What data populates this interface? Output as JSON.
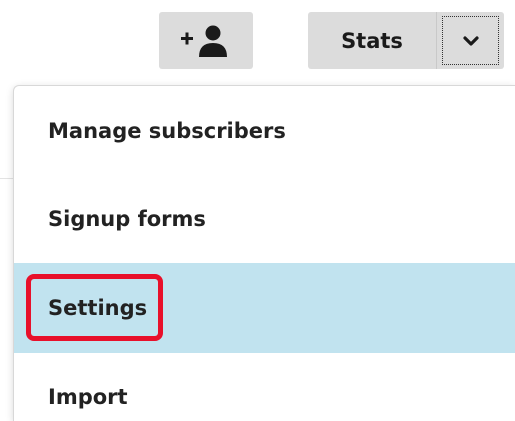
{
  "header": {
    "add_subscriber_icon": "add-user-icon",
    "stats_label": "Stats",
    "caret_icon": "chevron-down-icon"
  },
  "dropdown": {
    "items": [
      {
        "label": "Manage subscribers",
        "selected": false
      },
      {
        "label": "Signup forms",
        "selected": false
      },
      {
        "label": "Settings",
        "selected": true
      },
      {
        "label": "Import",
        "selected": false
      }
    ]
  },
  "colors": {
    "button_bg": "#dcdcdc",
    "selected_row_bg": "#c1e3ef",
    "annotation_red": "#e8102a",
    "text": "#222222"
  },
  "annotation": {
    "target": "Settings"
  }
}
